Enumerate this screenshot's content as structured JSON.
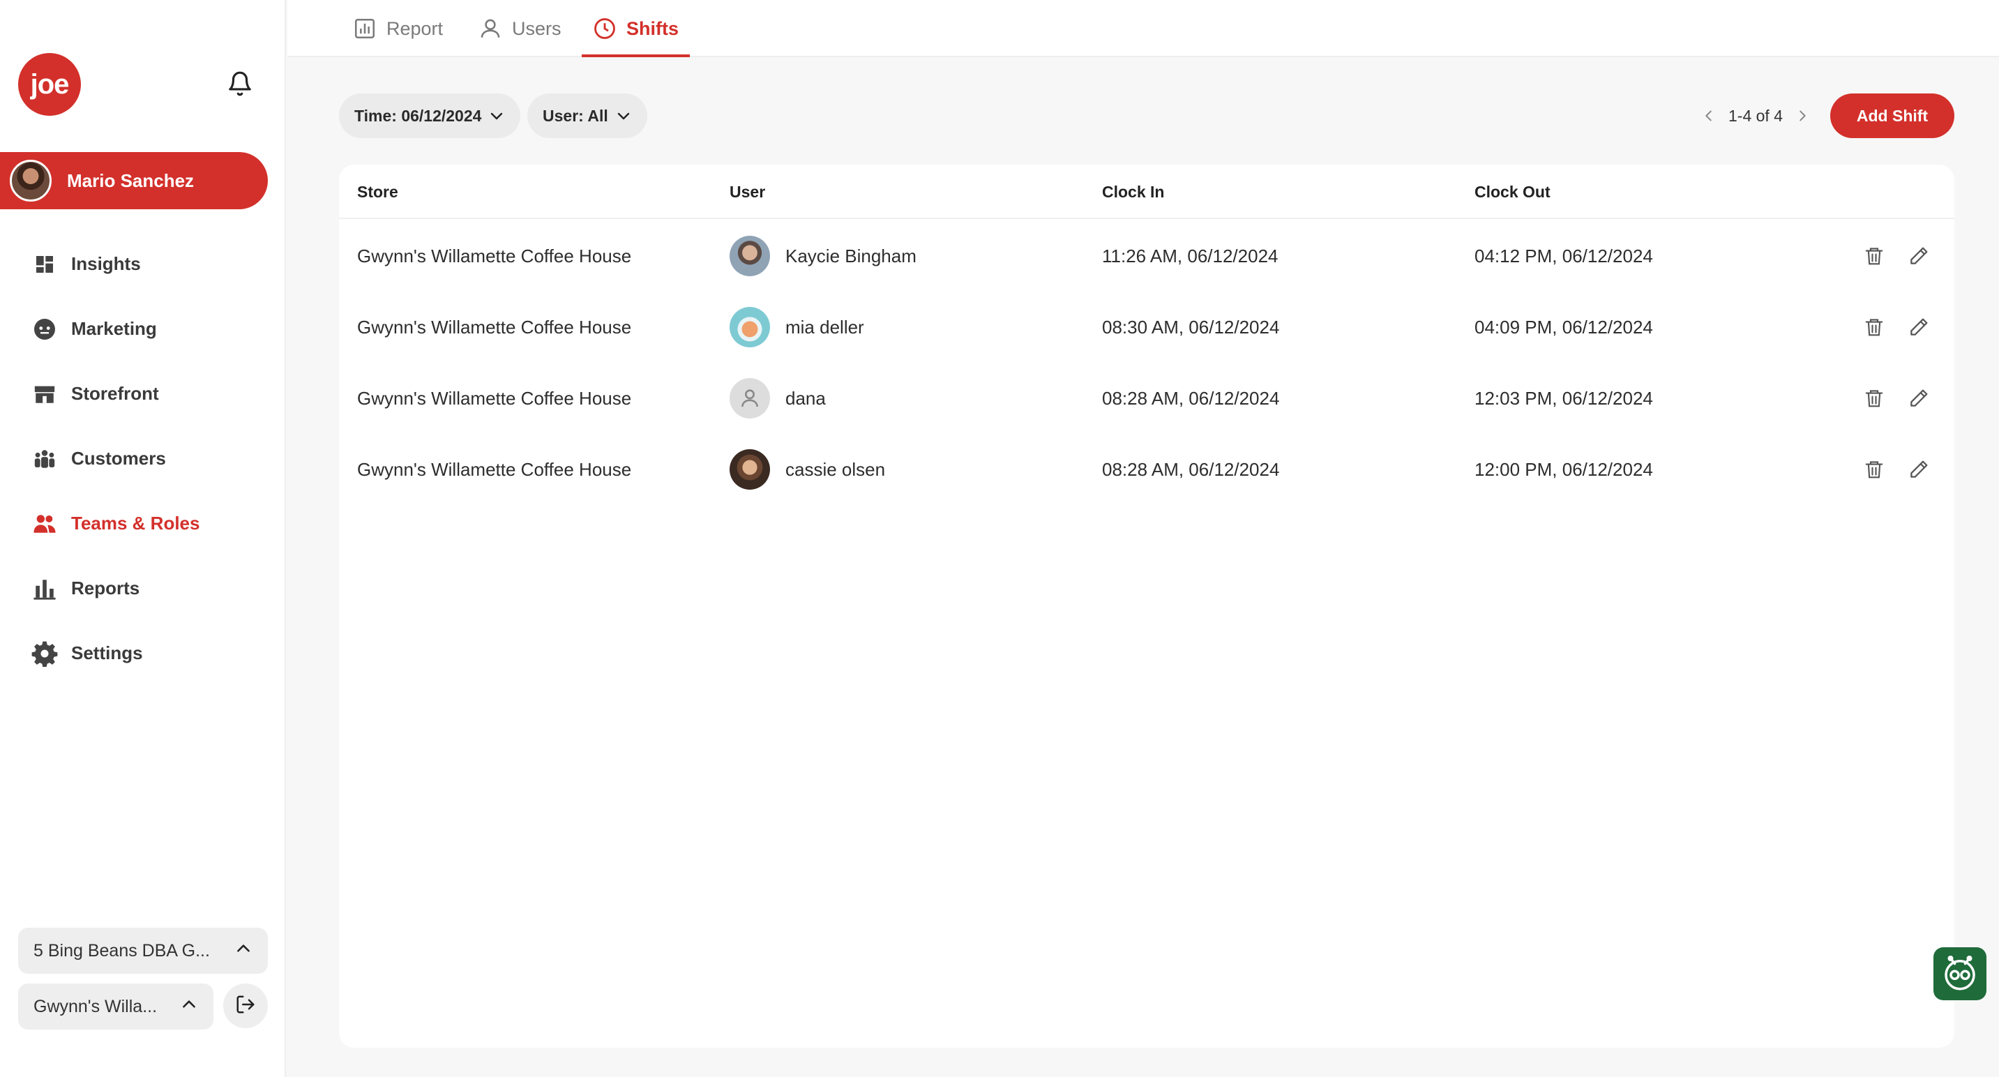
{
  "brand": {
    "logo_text": "joe",
    "accent_color": "#d3302b"
  },
  "profile": {
    "name": "Mario Sanchez"
  },
  "nav": {
    "items": [
      {
        "label": "Insights",
        "icon": "grid-icon",
        "active": false
      },
      {
        "label": "Marketing",
        "icon": "megaphone-icon",
        "active": false
      },
      {
        "label": "Storefront",
        "icon": "store-icon",
        "active": false
      },
      {
        "label": "Customers",
        "icon": "people-icon",
        "active": false
      },
      {
        "label": "Teams & Roles",
        "icon": "team-icon",
        "active": true
      },
      {
        "label": "Reports",
        "icon": "bar-chart-icon",
        "active": false
      },
      {
        "label": "Settings",
        "icon": "gear-icon",
        "active": false
      }
    ]
  },
  "store_selectors": {
    "business": "5 Bing Beans DBA G...",
    "location": "Gwynn's Willa..."
  },
  "tabs": [
    {
      "label": "Report",
      "icon": "report-icon"
    },
    {
      "label": "Users",
      "icon": "user-icon"
    },
    {
      "label": "Shifts",
      "icon": "clock-icon",
      "active": true
    }
  ],
  "filters": {
    "time": "Time: 06/12/2024",
    "user": "User: All"
  },
  "pagination": {
    "text": "1-4 of 4"
  },
  "actions": {
    "add_shift": "Add Shift"
  },
  "table": {
    "columns": [
      "Store",
      "User",
      "Clock In",
      "Clock Out"
    ],
    "rows": [
      {
        "store": "Gwynn's Willamette Coffee House",
        "user": "Kaycie Bingham",
        "clock_in": "11:26 AM, 06/12/2024",
        "clock_out": "04:12 PM, 06/12/2024",
        "avatar": "photo"
      },
      {
        "store": "Gwynn's Willamette Coffee House",
        "user": "mia deller",
        "clock_in": "08:30 AM, 06/12/2024",
        "clock_out": "04:09 PM, 06/12/2024",
        "avatar": "illustration"
      },
      {
        "store": "Gwynn's Willamette Coffee House",
        "user": "dana",
        "clock_in": "08:28 AM, 06/12/2024",
        "clock_out": "12:03 PM, 06/12/2024",
        "avatar": "placeholder"
      },
      {
        "store": "Gwynn's Willamette Coffee House",
        "user": "cassie olsen",
        "clock_in": "08:28 AM, 06/12/2024",
        "clock_out": "12:00 PM, 06/12/2024",
        "avatar": "photo"
      }
    ]
  }
}
